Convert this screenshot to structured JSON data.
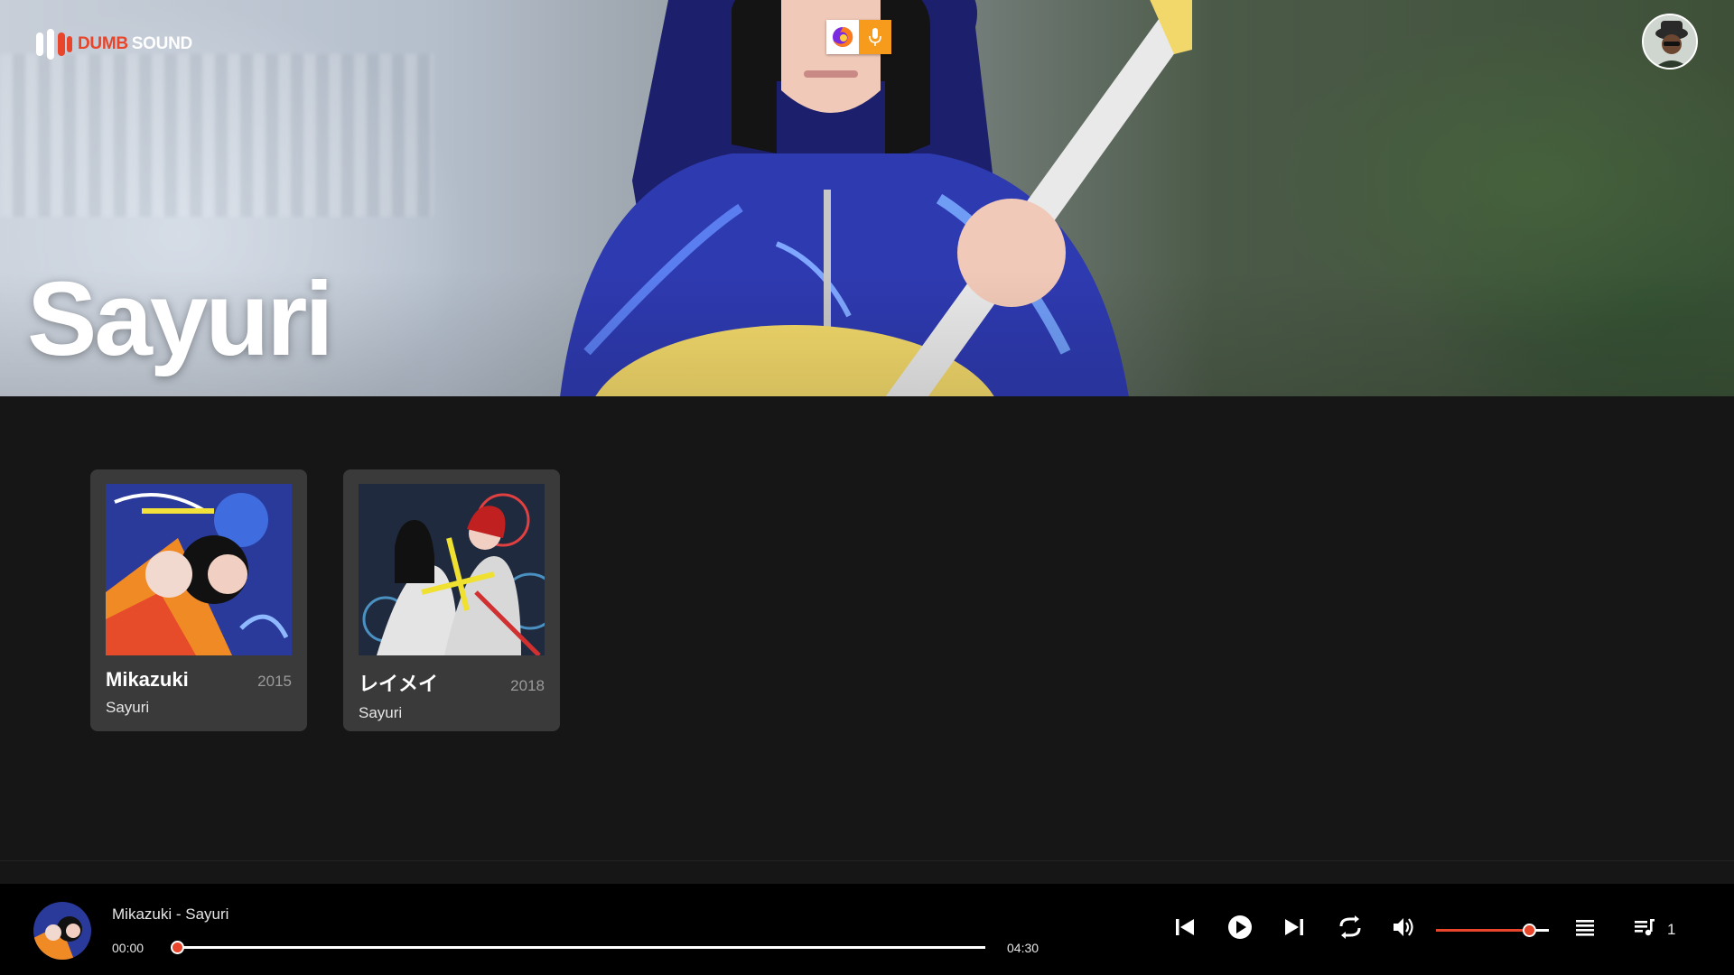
{
  "app": {
    "logo_word_a": "DUMB",
    "logo_word_b": "SOUND",
    "accent": "#e8452a"
  },
  "sharing_indicator": {
    "icons": [
      "firefox-icon",
      "microphone-icon"
    ],
    "mic_color": "#f79b1c"
  },
  "user": {
    "avatar": "user-avatar"
  },
  "artist": {
    "name": "Sayuri"
  },
  "albums": [
    {
      "title": "Mikazuki",
      "year": "2015",
      "artist": "Sayuri"
    },
    {
      "title": "レイメイ",
      "year": "2018",
      "artist": "Sayuri"
    }
  ],
  "player": {
    "now_playing": "Mikazuki - Sayuri",
    "current_time": "00:00",
    "total_time": "04:30",
    "progress": 0,
    "volume": 0.82,
    "queue_count": "1",
    "controls": [
      "previous-icon",
      "play-icon",
      "next-icon",
      "repeat-icon",
      "volume-icon",
      "playlist-icon",
      "queue-icon"
    ]
  }
}
